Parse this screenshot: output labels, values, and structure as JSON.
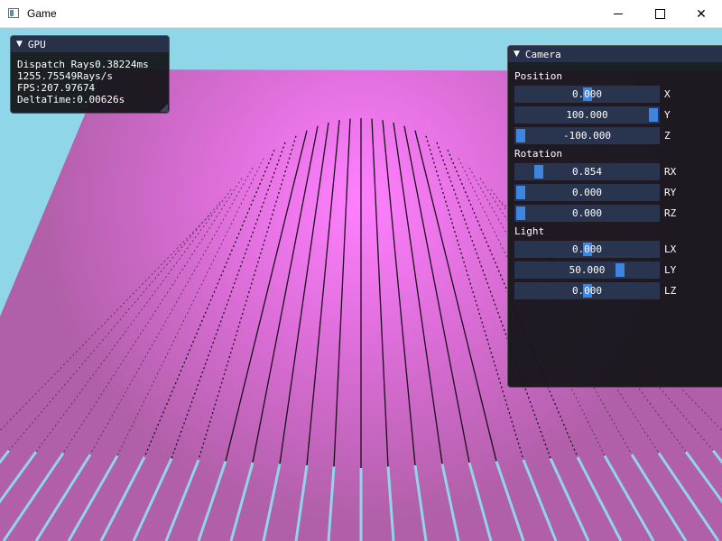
{
  "window": {
    "title": "Game",
    "controls": {
      "minimize": "minimize",
      "maximize": "maximize",
      "close": "✕"
    }
  },
  "colors": {
    "sky": "#8fd6e8",
    "ground": "#c46cbf",
    "ground_glow": "#ff80ff",
    "panel_bg": "#141418",
    "title_bg": "#28314a",
    "slider_bg": "#29344f",
    "slider_grab": "#3d85e0"
  },
  "gpu_panel": {
    "title": "GPU",
    "lines": [
      "Dispatch Rays0.38224ms",
      "1255.75549Rays/s",
      "FPS:207.97674",
      "DeltaTime:0.00626s"
    ]
  },
  "camera_panel": {
    "title": "Camera",
    "sections": [
      {
        "label": "Position",
        "fields": [
          {
            "axis": "X",
            "value": "0.000",
            "fraction": 0.5
          },
          {
            "axis": "Y",
            "value": "100.000",
            "fraction": 1.0
          },
          {
            "axis": "Z",
            "value": "-100.000",
            "fraction": 0.0
          }
        ]
      },
      {
        "label": "Rotation",
        "fields": [
          {
            "axis": "RX",
            "value": "0.854",
            "fraction": 0.136
          },
          {
            "axis": "RY",
            "value": "0.000",
            "fraction": 0.0
          },
          {
            "axis": "RZ",
            "value": "0.000",
            "fraction": 0.0
          }
        ]
      },
      {
        "label": "Light",
        "fields": [
          {
            "axis": "LX",
            "value": "0.000",
            "fraction": 0.5
          },
          {
            "axis": "LY",
            "value": "50.000",
            "fraction": 0.75
          },
          {
            "axis": "LZ",
            "value": "0.000",
            "fraction": 0.5
          }
        ]
      }
    ]
  }
}
